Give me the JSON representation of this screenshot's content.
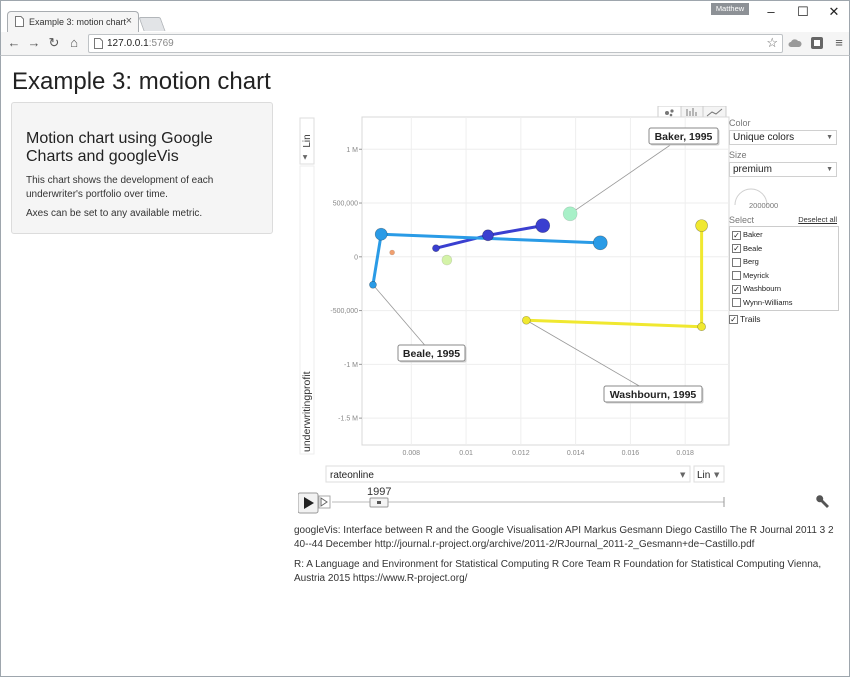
{
  "browser": {
    "tab_title": "Example 3: motion chart",
    "tab_close": "×",
    "profile_name": "Matthew",
    "url_host": "127.0.0.1",
    "url_port": ":5769",
    "window_controls": {
      "minimize": "–",
      "maximize": "☐",
      "close": "✕"
    },
    "nav": {
      "back": "←",
      "forward": "→",
      "reload": "↻",
      "home": "⌂",
      "star": "☆",
      "menu": "≡"
    }
  },
  "page": {
    "title": "Example 3: motion chart",
    "sidebar": {
      "heading": "Motion chart using Google Charts and googleVis",
      "text1": "This chart shows the development of each underwriter's portfolio over time.",
      "text2": "Axes can be set to any available metric."
    },
    "references": {
      "ref1": "googleVis: Interface between R and the Google Visualisation API Markus Gesmann Diego Castillo The R Journal 2011 3 2 40--44 December http://journal.r-project.org/archive/2011-2/RJournal_2011-2_Gesmann+de~Castillo.pdf",
      "ref2": "R: A Language and Environment for Statistical Computing R Core Team R Foundation for Statistical Computing Vienna, Austria 2015 https://www.R-project.org/"
    }
  },
  "controls": {
    "color_label": "Color",
    "color_value": "Unique colors",
    "size_label": "Size",
    "size_value": "premium",
    "size_max": "2000000",
    "select_label": "Select",
    "deselect_all": "Deselect all",
    "trails_label": "Trails",
    "trails_checked": true,
    "x_metric": "rateonline",
    "x_scale": "Lin",
    "y_metric": "underwritingprofit",
    "y_scale": "Lin",
    "year": "1997",
    "play_icon": "play-icon",
    "step_icon": "step-icon",
    "settings_icon": "wrench-icon",
    "underwriters": [
      {
        "name": "Baker",
        "checked": true
      },
      {
        "name": "Beale",
        "checked": true
      },
      {
        "name": "Berg",
        "checked": false
      },
      {
        "name": "Meyrick",
        "checked": false
      },
      {
        "name": "Washbourn",
        "checked": true
      },
      {
        "name": "Wynn-Williams",
        "checked": false
      }
    ]
  },
  "chart_data": {
    "type": "scatter",
    "x_ticks": [
      "0.008",
      "0.01",
      "0.012",
      "0.014",
      "0.016",
      "0.018"
    ],
    "x_tick_values": [
      0.008,
      0.01,
      0.012,
      0.014,
      0.016,
      0.018
    ],
    "y_ticks": [
      "1 M",
      "500,000",
      "0",
      "-500,000",
      "-1 M",
      "-1.5 M"
    ],
    "y_tick_values": [
      1000000,
      500000,
      0,
      -500000,
      -1000000,
      -1500000
    ],
    "xlim": [
      0.0062,
      0.0196
    ],
    "ylim": [
      -1750000,
      1300000
    ],
    "grid": true,
    "colors": {
      "baker": "#3a3fd0",
      "beale": "#2a9be6",
      "washbourn": "#f0e830"
    },
    "trails": [
      {
        "name": "Baker",
        "color": "#3a3fd0",
        "points": [
          [
            0.0089,
            80000
          ],
          [
            0.0108,
            200000
          ],
          [
            0.0128,
            290000
          ]
        ]
      },
      {
        "name": "Beale",
        "color": "#2a9be6",
        "points": [
          [
            0.0066,
            -260000
          ],
          [
            0.0069,
            210000
          ],
          [
            0.0149,
            130000
          ]
        ]
      },
      {
        "name": "Washbourn",
        "color": "#f0e830",
        "points": [
          [
            0.0122,
            -590000
          ],
          [
            0.0186,
            -650000
          ],
          [
            0.0186,
            290000
          ]
        ]
      }
    ],
    "bubbles": [
      {
        "x": 0.0138,
        "y": 400000,
        "r": 7,
        "color": "#a8f0c8"
      },
      {
        "x": 0.0093,
        "y": -30000,
        "r": 5,
        "color": "#d4f3a8"
      },
      {
        "x": 0.0073,
        "y": 40000,
        "r": 2.5,
        "color": "#f0a070"
      }
    ],
    "callouts": [
      {
        "label": "Baker, 1995",
        "x": 0.0138,
        "y": 400000
      },
      {
        "label": "Beale, 1995",
        "x": 0.0066,
        "y": -260000
      },
      {
        "label": "Washbourn, 1995",
        "x": 0.0122,
        "y": -590000
      }
    ]
  }
}
